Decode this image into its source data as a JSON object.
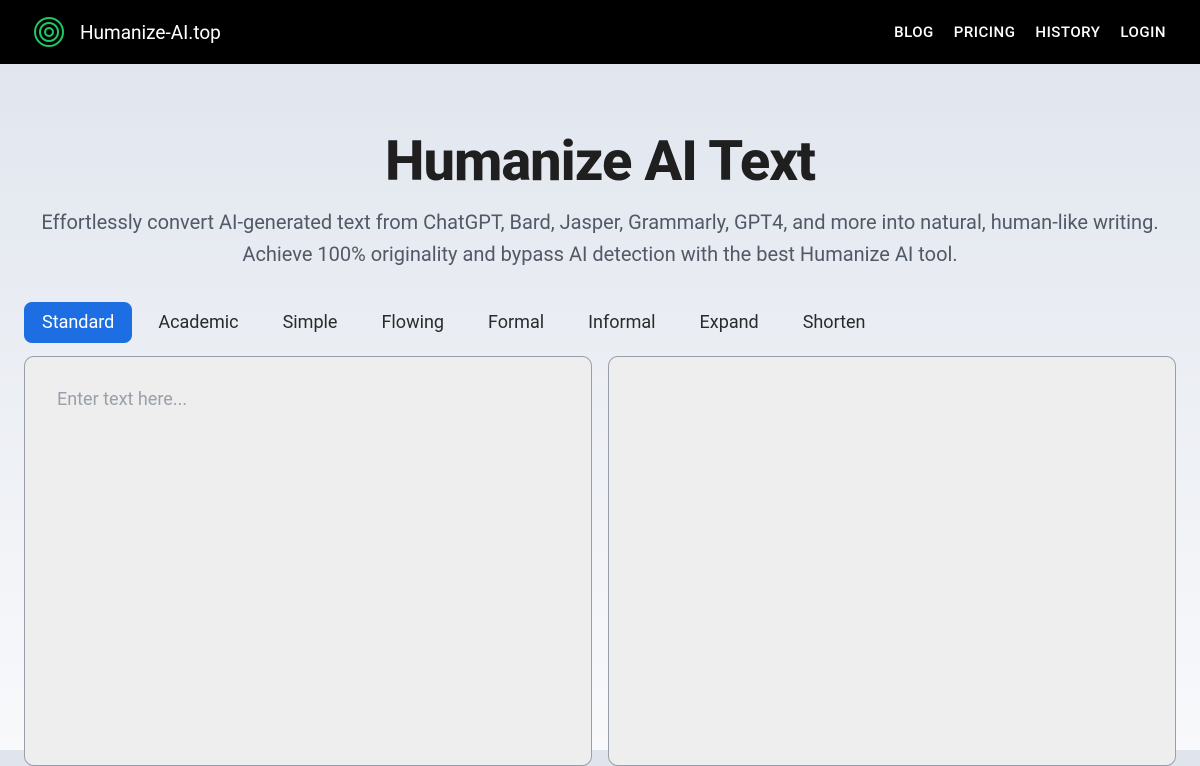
{
  "header": {
    "siteName": "Humanize-AI.top",
    "nav": {
      "blog": "BLOG",
      "pricing": "PRICING",
      "history": "HISTORY",
      "login": "LOGIN"
    }
  },
  "main": {
    "title": "Humanize AI Text",
    "subtitle": "Effortlessly convert AI-generated text from ChatGPT, Bard, Jasper, Grammarly, GPT4, and more into natural, human-like writing. Achieve 100% originality and bypass AI detection with the best Humanize AI tool."
  },
  "tabs": {
    "standard": "Standard",
    "academic": "Academic",
    "simple": "Simple",
    "flowing": "Flowing",
    "formal": "Formal",
    "informal": "Informal",
    "expand": "Expand",
    "shorten": "Shorten"
  },
  "input": {
    "placeholder": "Enter text here...",
    "value": ""
  },
  "output": {
    "value": ""
  }
}
